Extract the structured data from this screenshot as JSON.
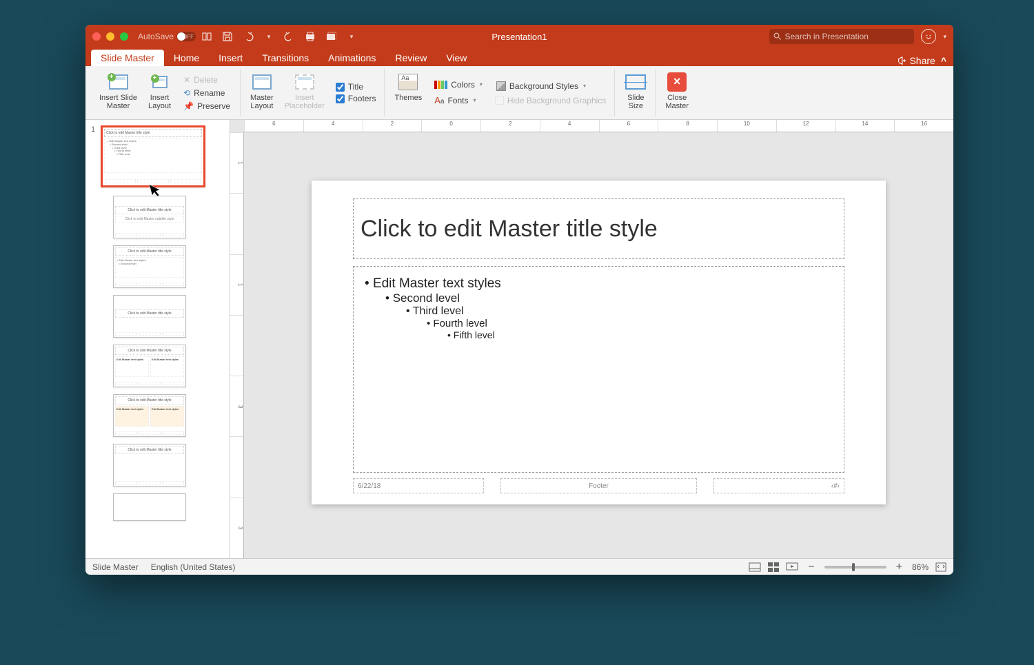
{
  "titlebar": {
    "autosave_label": "AutoSave",
    "autosave_state": "OFF",
    "document_title": "Presentation1",
    "search_placeholder": "Search in Presentation"
  },
  "tabs": {
    "items": [
      "Slide Master",
      "Home",
      "Insert",
      "Transitions",
      "Animations",
      "Review",
      "View"
    ],
    "active": "Slide Master",
    "share": "Share"
  },
  "ribbon": {
    "insert_master": "Insert Slide\nMaster",
    "insert_layout": "Insert\nLayout",
    "delete": "Delete",
    "rename": "Rename",
    "preserve": "Preserve",
    "master_layout": "Master\nLayout",
    "insert_placeholder": "Insert\nPlaceholder",
    "title_chk": "Title",
    "footers_chk": "Footers",
    "themes": "Themes",
    "colors": "Colors",
    "fonts": "Fonts",
    "bg_styles": "Background Styles",
    "hide_bg": "Hide Background Graphics",
    "slide_size": "Slide\nSize",
    "close_master": "Close\nMaster"
  },
  "ruler_h": [
    "6",
    "4",
    "2",
    "0",
    "2",
    "4",
    "6",
    "8",
    "10",
    "12",
    "14",
    "16"
  ],
  "ruler_v": [
    "1",
    "",
    "1",
    "",
    "3",
    "",
    "3"
  ],
  "slide": {
    "title_ph": "Click to edit Master title style",
    "body_levels": [
      "Edit Master text styles",
      "Second level",
      "Third level",
      "Fourth level",
      "Fifth level"
    ],
    "date": "6/22/18",
    "footer": "Footer",
    "pagenum": "‹#›"
  },
  "thumbs": {
    "master_num": "1",
    "master_title": "Click to edit Master title style",
    "master_body": "• Edit Master text styles\n   • Second level\n      • Third level\n         • Fourth level\n            • Fifth level",
    "layout_title": "Click to edit Master title style",
    "layout_sub": "Click to edit Master subtitle style"
  },
  "status": {
    "view": "Slide Master",
    "lang": "English (United States)",
    "zoom": "86%"
  }
}
